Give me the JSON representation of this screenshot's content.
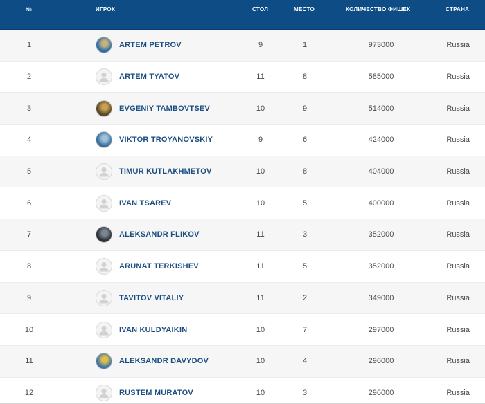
{
  "columns": {
    "num": "№",
    "player": "ИГРОК",
    "table": "СТОЛ",
    "place": "МЕСТО",
    "chips": "КОЛИЧЕСТВО ФИШЕК",
    "country": "СТРАНА"
  },
  "colors": {
    "header_bg": "#0e4c86",
    "player_name": "#1b4e83",
    "row_alt": "#f6f6f6"
  },
  "rows": [
    {
      "num": "1",
      "name": "ARTEM PETROV",
      "table": "9",
      "place": "1",
      "chips": "973000",
      "country": "Russia",
      "avatar": "photo",
      "photo_colors": [
        "#2f6fa8",
        "#c9b27a"
      ]
    },
    {
      "num": "2",
      "name": "ARTEM TYATOV",
      "table": "11",
      "place": "8",
      "chips": "585000",
      "country": "Russia",
      "avatar": "default-user-icon"
    },
    {
      "num": "3",
      "name": "EVGENIY TAMBOVTSEV",
      "table": "10",
      "place": "9",
      "chips": "514000",
      "country": "Russia",
      "avatar": "photo",
      "photo_colors": [
        "#5a4a2c",
        "#c8a050"
      ]
    },
    {
      "num": "4",
      "name": "VIKTOR TROYANOVSKIY",
      "table": "9",
      "place": "6",
      "chips": "424000",
      "country": "Russia",
      "avatar": "photo",
      "photo_colors": [
        "#3a6e9a",
        "#9fc3de"
      ]
    },
    {
      "num": "5",
      "name": "TIMUR KUTLAKHMETOV",
      "table": "10",
      "place": "8",
      "chips": "404000",
      "country": "Russia",
      "avatar": "default-user-icon"
    },
    {
      "num": "6",
      "name": "IVAN TSAREV",
      "table": "10",
      "place": "5",
      "chips": "400000",
      "country": "Russia",
      "avatar": "default-user-icon"
    },
    {
      "num": "7",
      "name": "ALEKSANDR FLIKOV",
      "table": "11",
      "place": "3",
      "chips": "352000",
      "country": "Russia",
      "avatar": "photo",
      "photo_colors": [
        "#2d3138",
        "#7a8590"
      ]
    },
    {
      "num": "8",
      "name": "ARUNAT TERKISHEV",
      "table": "11",
      "place": "5",
      "chips": "352000",
      "country": "Russia",
      "avatar": "default-user-icon"
    },
    {
      "num": "9",
      "name": "TAVITOV VITALIY",
      "table": "11",
      "place": "2",
      "chips": "349000",
      "country": "Russia",
      "avatar": "default-user-icon"
    },
    {
      "num": "10",
      "name": "IVAN KULDYAIKIN",
      "table": "10",
      "place": "7",
      "chips": "297000",
      "country": "Russia",
      "avatar": "default-user-icon"
    },
    {
      "num": "11",
      "name": "ALEKSANDR DAVYDOV",
      "table": "10",
      "place": "4",
      "chips": "296000",
      "country": "Russia",
      "avatar": "photo",
      "photo_colors": [
        "#3f74a9",
        "#e1c04a"
      ]
    },
    {
      "num": "12",
      "name": "RUSTEM MURATOV",
      "table": "10",
      "place": "3",
      "chips": "296000",
      "country": "Russia",
      "avatar": "default-user-icon"
    }
  ]
}
